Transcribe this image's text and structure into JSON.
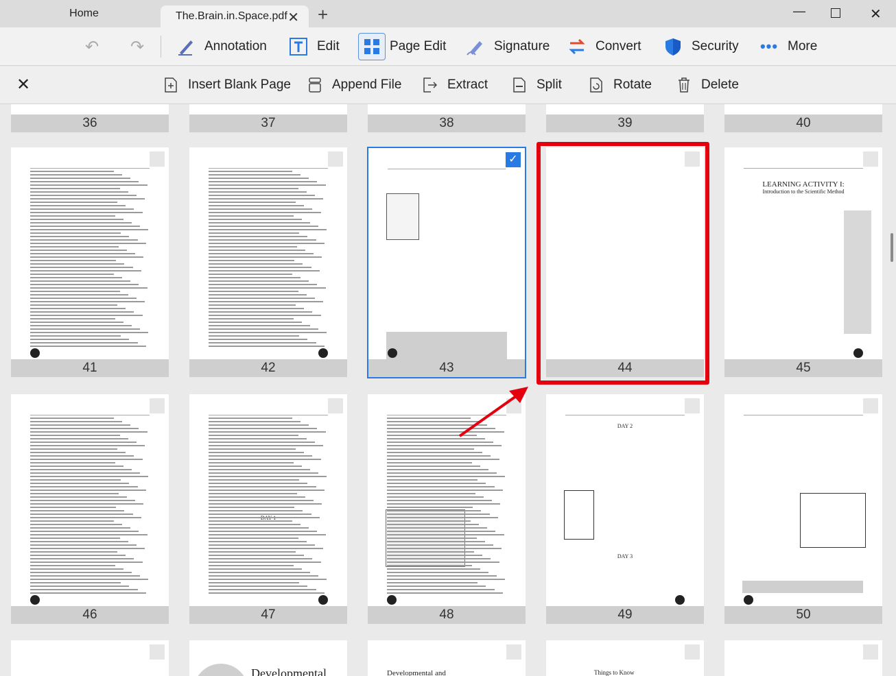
{
  "tabs": {
    "home": "Home",
    "document": "The.Brain.in.Space.pdf"
  },
  "toolbar": {
    "annotation": "Annotation",
    "edit": "Edit",
    "page_edit": "Page Edit",
    "signature": "Signature",
    "convert": "Convert",
    "security": "Security",
    "more": "More"
  },
  "page_edit_bar": {
    "insert_blank_page": "Insert Blank Page",
    "append_file": "Append File",
    "extract": "Extract",
    "split": "Split",
    "rotate": "Rotate",
    "delete": "Delete"
  },
  "pages": {
    "row0": [
      "36",
      "37",
      "38",
      "39",
      "40"
    ],
    "row1": [
      "41",
      "42",
      "43",
      "44",
      "45"
    ],
    "row2": [
      "46",
      "47",
      "48",
      "49",
      "50"
    ]
  },
  "page45": {
    "title": "LEARNING ACTIVITY I:",
    "subtitle": "Introduction to the Scientific Method"
  },
  "page49": {
    "heading1": "DAY 2",
    "heading2": "DAY 3"
  },
  "page47": {
    "heading": "DAY 1"
  },
  "row3": {
    "developmental": "Developmental",
    "developmental_and": "Developmental and",
    "things_to_know": "Things to Know"
  },
  "colors": {
    "selected": "#2a7ae4",
    "highlight": "#e3000f"
  }
}
